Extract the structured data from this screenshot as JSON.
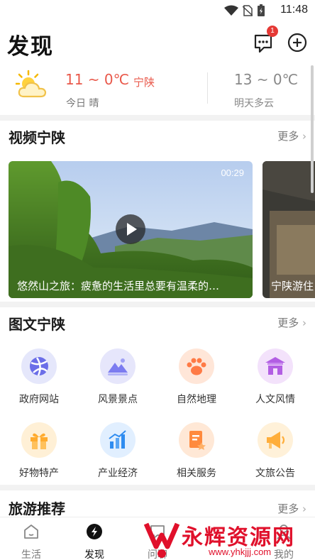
{
  "status_bar": {
    "time": "11:48"
  },
  "header": {
    "title": "发现",
    "message_badge": "1"
  },
  "weather": {
    "today_temp": "11 ~ 0℃",
    "today_city": "宁陕",
    "today_desc": "今日 晴",
    "tomorrow_temp": "13 ~ 0℃",
    "tomorrow_desc": "明天多云"
  },
  "video_section": {
    "title": "视频宁陕",
    "more": "更多",
    "cards": [
      {
        "duration": "00:29",
        "caption": "悠然山之旅：疲惫的生活里总要有温柔的…"
      },
      {
        "caption": "宁陕游住"
      }
    ]
  },
  "photo_section": {
    "title": "图文宁陕",
    "more": "更多",
    "categories": [
      {
        "label": "政府网站",
        "icon": "globe-icon",
        "color": "#6b6ee8"
      },
      {
        "label": "风景景点",
        "icon": "mountain-icon",
        "color": "#7c7cf0"
      },
      {
        "label": "自然地理",
        "icon": "paw-icon",
        "color": "#ff7a45"
      },
      {
        "label": "人文风情",
        "icon": "pavilion-icon",
        "color": "#b25ee3"
      },
      {
        "label": "好物特产",
        "icon": "gift-icon",
        "color": "#ffab2e"
      },
      {
        "label": "产业经济",
        "icon": "bar-chart-icon",
        "color": "#2f8cf0"
      },
      {
        "label": "相关服务",
        "icon": "document-icon",
        "color": "#ff8a3d"
      },
      {
        "label": "文旅公告",
        "icon": "megaphone-icon",
        "color": "#ffae3b"
      }
    ]
  },
  "travel_section": {
    "title": "旅游推荐",
    "more": "更多"
  },
  "tabbar": {
    "tabs": [
      {
        "label": "生活",
        "icon": "home-icon"
      },
      {
        "label": "发现",
        "icon": "discover-icon",
        "active": true
      },
      {
        "label": "问聊",
        "icon": "chat-icon"
      },
      {
        "label": "我的",
        "icon": "user-icon"
      }
    ]
  },
  "watermark": {
    "text": "永辉资源网",
    "url": "www.yhkjjj.com"
  },
  "colors": {
    "accent": "#e9584a",
    "watermark": "#e0102b"
  }
}
